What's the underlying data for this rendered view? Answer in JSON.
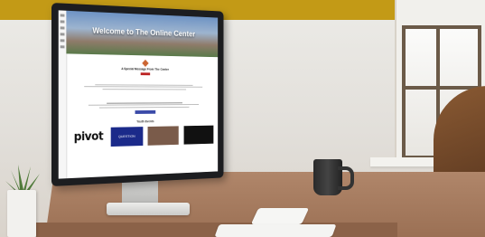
{
  "website": {
    "hero_title": "Welcome to The Online Center",
    "message_heading": "A Special Message From The Center",
    "youth_events_heading": "Youth Events",
    "events": [
      {
        "label": "pivot"
      },
      {
        "label": "QUESTION"
      },
      {
        "label": ""
      },
      {
        "label": ""
      }
    ]
  }
}
